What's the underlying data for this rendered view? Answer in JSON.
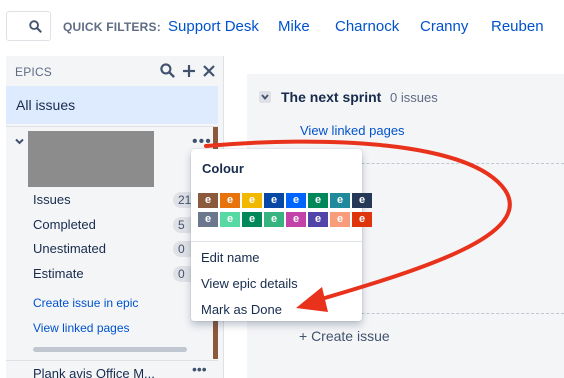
{
  "topbar": {
    "search_icon": "search-icon",
    "quick_filters_label": "QUICK FILTERS:",
    "filters": [
      "Support Desk",
      "Mike",
      "Charnock",
      "Cranny",
      "Reuben"
    ]
  },
  "epics": {
    "title": "EPICS",
    "icons": [
      "search-icon",
      "plus-icon",
      "close-icon"
    ],
    "all_issues": "All issues",
    "card": {
      "color": "#8b5a3c",
      "stats": [
        {
          "label": "Issues",
          "value": "21"
        },
        {
          "label": "Completed",
          "value": "5"
        },
        {
          "label": "Unestimated",
          "value": "0"
        },
        {
          "label": "Estimate",
          "value": "0"
        }
      ],
      "links": [
        "Create issue in epic",
        "View linked pages"
      ]
    },
    "next_epic_label": "Plank avis Office M..."
  },
  "sprint": {
    "title": "The next sprint",
    "count": "0 issues",
    "link": "View linked pages",
    "create_issue": "+ Create issue"
  },
  "menu": {
    "heading": "Colour",
    "swatch_letter": "e",
    "swatch_rows": [
      [
        "#8b5a3c",
        "#e8720c",
        "#f2b800",
        "#0747a6",
        "#0065ff",
        "#00875a",
        "#1f8a9c",
        "#253858"
      ],
      [
        "#6b778c",
        "#57d9a3",
        "#00875a",
        "#36b37e",
        "#c342a8",
        "#5243aa",
        "#f99c7c",
        "#de350b"
      ]
    ],
    "items": [
      "Edit name",
      "View epic details",
      "Mark as Done"
    ]
  },
  "annotation": {
    "arrow_color": "#e8321b"
  }
}
